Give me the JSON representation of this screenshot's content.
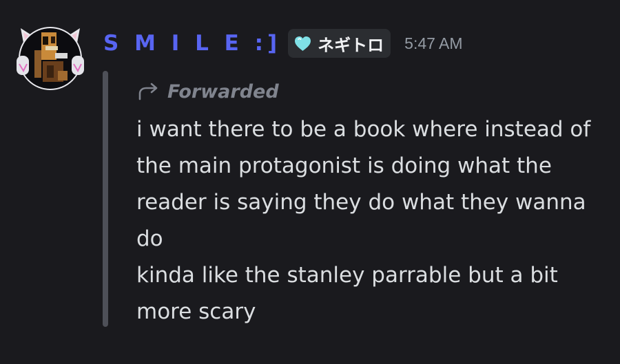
{
  "author": {
    "name": "S M I L E :]",
    "name_color": "#5865f2"
  },
  "role_tag": {
    "name": "ネギトロ",
    "icon": "cyan-heart-icon",
    "icon_color": "#7fe0e6"
  },
  "timestamp": "5:47 AM",
  "forwarded": {
    "label": "Forwarded",
    "icon": "forward-arrow-icon"
  },
  "message": {
    "lines": [
      "i want there to be a book where instead of",
      "the main protagonist is doing what the",
      "reader is saying they do what they wanna",
      "do",
      "kinda like the stanley parrable but a bit",
      "more scary"
    ]
  },
  "colors": {
    "background": "#1a1a1e",
    "text": "#dbdee1",
    "muted": "#949ba4",
    "quote_bar": "#4e5058",
    "role_bg": "#2b2d31"
  }
}
